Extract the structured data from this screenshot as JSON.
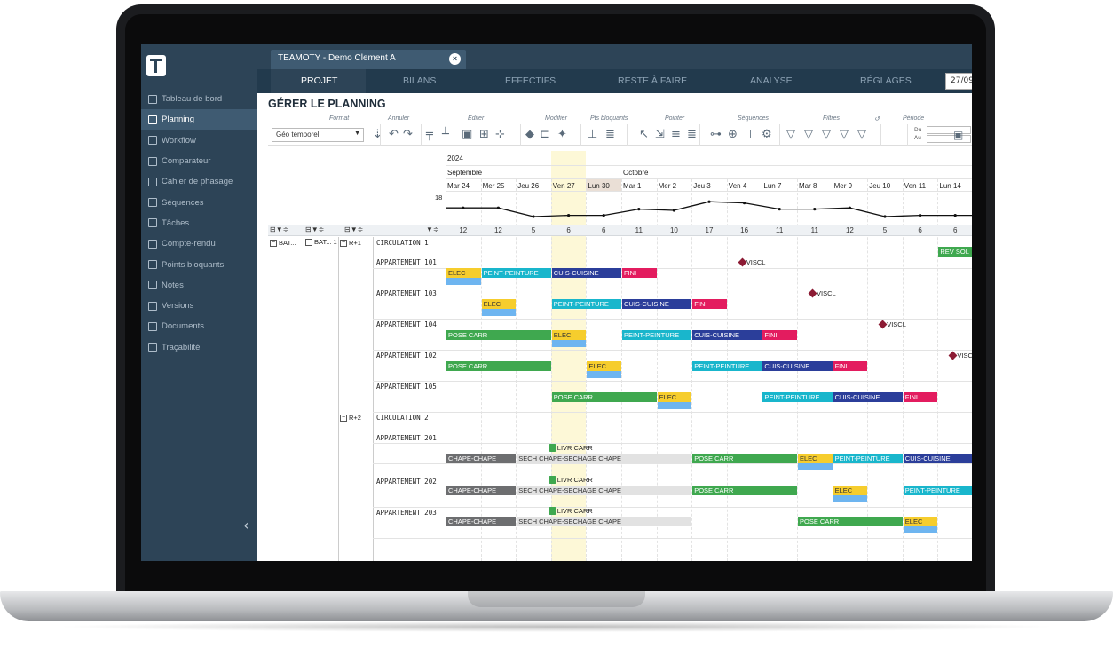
{
  "app": {
    "tab_title": "TEAMOTY - Demo Clement A",
    "tab_close": "×"
  },
  "sidebar": {
    "collapse_glyph": "‹",
    "items": [
      {
        "label": "Tableau de bord",
        "active": false
      },
      {
        "label": "Planning",
        "active": true
      },
      {
        "label": "Workflow",
        "active": false
      },
      {
        "label": "Comparateur",
        "active": false
      },
      {
        "label": "Cahier de phasage",
        "active": false
      },
      {
        "label": "Séquences",
        "active": false
      },
      {
        "label": "Tâches",
        "active": false
      },
      {
        "label": "Compte-rendu",
        "active": false
      },
      {
        "label": "Points bloquants",
        "active": false
      },
      {
        "label": "Notes",
        "active": false
      },
      {
        "label": "Versions",
        "active": false
      },
      {
        "label": "Documents",
        "active": false
      },
      {
        "label": "Traçabilité",
        "active": false
      }
    ]
  },
  "menu": {
    "items": [
      "PROJET",
      "BILANS",
      "EFFECTIFS",
      "RESTE À FAIRE",
      "ANALYSE",
      "RÉGLAGES"
    ],
    "active": "PROJET",
    "date_value": "27/09/"
  },
  "page": {
    "title": "GÉRER LE PLANNING"
  },
  "toolbar": {
    "groups": [
      "Format",
      "Annuler",
      "Editer",
      "Modifier",
      "Pts bloquants",
      "Pointer",
      "Séquences",
      "Filtres",
      "↺",
      "Période"
    ],
    "format_value": "Géo temporel",
    "du_label": "Du",
    "au_label": "Au"
  },
  "gantt": {
    "year": "2024",
    "months": [
      "Septembre",
      "Octobre"
    ],
    "days": [
      "Mar 24",
      "Mer 25",
      "Jeu 26",
      "Ven 27",
      "Lun 30",
      "Mar 1",
      "Mer 2",
      "Jeu 3",
      "Ven 4",
      "Lun 7",
      "Mar 8",
      "Mer 9",
      "Jeu 10",
      "Ven 11",
      "Lun 14"
    ],
    "counts": [
      12,
      12,
      5,
      6,
      6,
      11,
      10,
      17,
      16,
      11,
      11,
      12,
      5,
      6,
      6
    ],
    "graph_label": "18",
    "tree": {
      "col1": "BAT...",
      "col2": "BAT... 1",
      "level1": "R+1",
      "level2": "R+2"
    },
    "rows": [
      "CIRCULATION 1",
      "APPARTEMENT 101",
      "APPARTEMENT 103",
      "APPARTEMENT 104",
      "APPARTEMENT 102",
      "APPARTEMENT 105",
      "CIRCULATION 2",
      "APPARTEMENT 201",
      "APPARTEMENT 202",
      "APPARTEMENT 203"
    ],
    "footer_icons": "↕ ⤮ ≋ +"
  },
  "colors": {
    "sidebar": "#2d4457",
    "ELEC": "#f6cd2d",
    "PEINT-PEINTURE": "#19b6cc",
    "CUIS-CUISINE": "#2b3e9a",
    "FINI": "#e31c5f",
    "POSE CARR": "#3fa84f",
    "REV SOL": "#3fa84f",
    "CHAPE-CHAPE": "#6d6e70",
    "SECH": "#e2e2e2",
    "milestone": "#8c1b34"
  },
  "labels": {
    "elec": "ELEC",
    "peint": "PEINT-PEINTURE",
    "cuis": "CUIS-CUISINE",
    "fini": "FINI",
    "pose": "POSE CARR",
    "revsol": "REV SOL",
    "chape": "CHAPE-CHAPE",
    "sech": "SECH CHAPE-SECHAGE CHAPE",
    "livr": "LIVR CARR",
    "viscl": "VISCL"
  }
}
